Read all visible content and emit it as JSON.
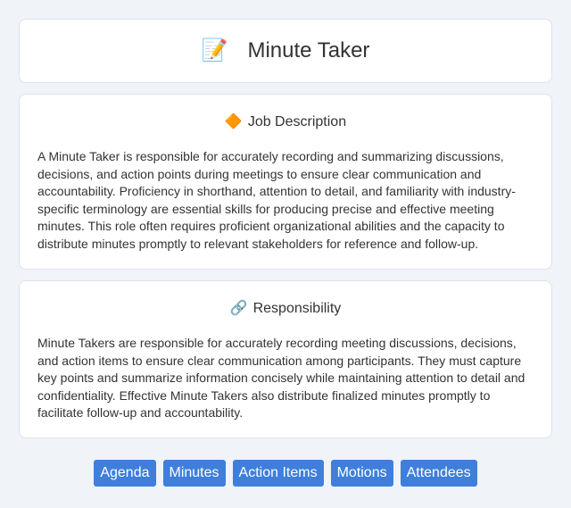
{
  "header": {
    "title": "Minute Taker",
    "icon": "memo-icon"
  },
  "job_description": {
    "heading": "Job Description",
    "icon": "diamond-icon",
    "text": "A Minute Taker is responsible for accurately recording and summarizing discussions, decisions, and action points during meetings to ensure clear communication and accountability. Proficiency in shorthand, attention to detail, and familiarity with industry-specific terminology are essential skills for producing precise and effective meeting minutes. This role often requires proficient organizational abilities and the capacity to distribute minutes promptly to relevant stakeholders for reference and follow-up."
  },
  "responsibility": {
    "heading": "Responsibility",
    "icon": "link-icon",
    "text": "Minute Takers are responsible for accurately recording meeting discussions, decisions, and action items to ensure clear communication among participants. They must capture key points and summarize information concisely while maintaining attention to detail and confidentiality. Effective Minute Takers also distribute finalized minutes promptly to facilitate follow-up and accountability."
  },
  "tags": [
    "Agenda",
    "Minutes",
    "Action Items",
    "Motions",
    "Attendees"
  ],
  "colors": {
    "tag_background": "#3f7fdb",
    "page_background": "#f0f3f8"
  }
}
